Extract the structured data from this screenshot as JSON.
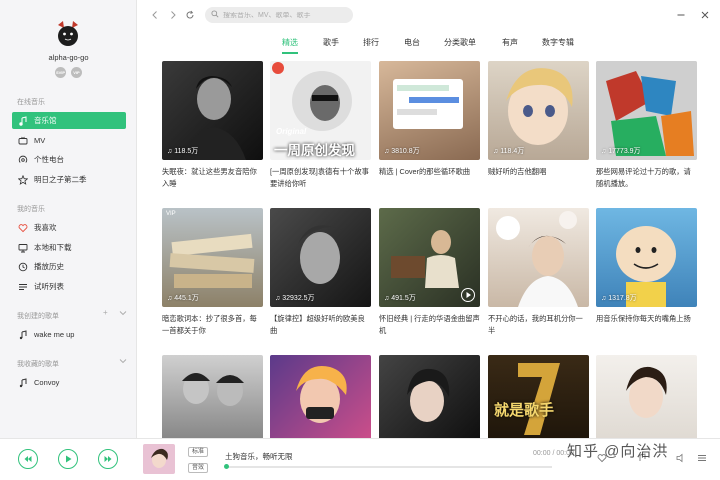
{
  "user": {
    "name": "alpha-go-go",
    "badges": [
      "SVIP",
      "VIP"
    ]
  },
  "search": {
    "placeholder": "搜索音乐、MV、歌单、歌手"
  },
  "sidebar": {
    "online_title": "在线音乐",
    "online_items": [
      {
        "label": "音乐馆",
        "icon": "music-note-icon",
        "active": true
      },
      {
        "label": "MV",
        "icon": "tv-icon"
      },
      {
        "label": "个性电台",
        "icon": "radio-icon"
      },
      {
        "label": "明日之子第二季",
        "icon": "star-icon"
      }
    ],
    "my_title": "我的音乐",
    "my_items": [
      {
        "label": "我喜欢",
        "icon": "heart-icon"
      },
      {
        "label": "本地和下载",
        "icon": "computer-icon"
      },
      {
        "label": "播放历史",
        "icon": "clock-icon"
      },
      {
        "label": "试听列表",
        "icon": "list-icon"
      }
    ],
    "created_title": "我创建的歌单",
    "created_items": [
      {
        "label": "wake me up",
        "icon": "music-note-icon"
      }
    ],
    "collected_title": "我收藏的歌单",
    "collected_items": [
      {
        "label": "Convoy",
        "icon": "music-note-icon"
      }
    ]
  },
  "tabs": [
    "精选",
    "歌手",
    "排行",
    "电台",
    "分类歌单",
    "有声",
    "数字专辑"
  ],
  "active_tab": 0,
  "cards": [
    {
      "plays": "118.5万",
      "title": "失眠夜：就让这些男友音陪你入睡",
      "cover_text": ""
    },
    {
      "plays": "",
      "title": "[一周原创发现]袁德有十个故事要讲给你听",
      "cover_text": "一周原创发现",
      "cover_subtext": "Original"
    },
    {
      "plays": "3810.8万",
      "title": "精选 | Cover的那些循环歌曲",
      "cover_text": ""
    },
    {
      "plays": "118.4万",
      "title": "贼好听的吉他翻唱",
      "cover_text": ""
    },
    {
      "plays": "17773.9万",
      "title": "那些网易评论过十万的歌，请随机播放。",
      "cover_text": ""
    },
    {
      "plays": "445.1万",
      "title": "暗恋歌词本：抄了很多首，每一首都关于你",
      "cover_text": "",
      "tag": "VIP"
    },
    {
      "plays": "32932.5万",
      "title": "【旋律控】超级好听的欧美良曲",
      "cover_text": ""
    },
    {
      "plays": "491.5万",
      "title": "怀旧经典 | 行走的华语金曲留声机",
      "cover_text": ""
    },
    {
      "plays": "",
      "title": "不开心的话，我的耳机分你一半",
      "cover_text": ""
    },
    {
      "plays": "1317.8万",
      "title": "用音乐保持你每天的嘴角上扬",
      "cover_text": ""
    },
    {
      "plays": "",
      "title": "",
      "cover_text": ""
    },
    {
      "plays": "",
      "title": "",
      "cover_text": ""
    },
    {
      "plays": "",
      "title": "",
      "cover_text": ""
    },
    {
      "plays": "",
      "title": "",
      "cover_text": "就是歌手"
    },
    {
      "plays": "",
      "title": "",
      "cover_text": ""
    }
  ],
  "player": {
    "song": "土狗音乐，畅听无限",
    "time": "00:00 / 00:00",
    "quality_tag": "标准",
    "effect_tag": "音效"
  },
  "watermark": "知乎 @向治洪",
  "colors": {
    "accent": "#31c27c"
  }
}
